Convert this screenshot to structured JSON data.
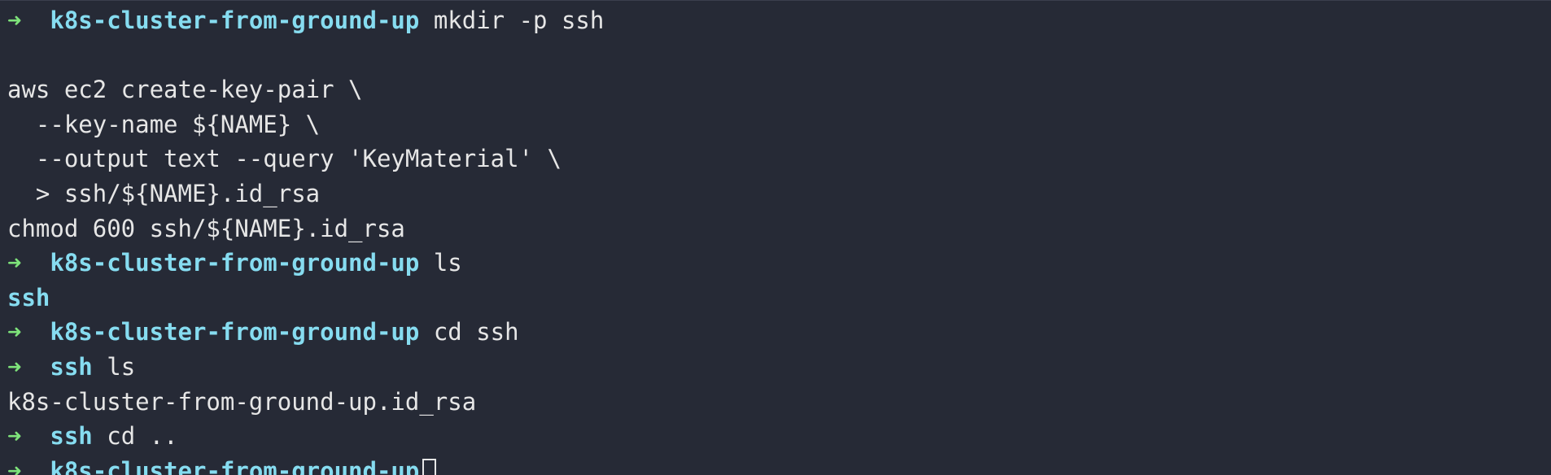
{
  "terminal": {
    "prompt_symbol": "➜",
    "lines": [
      {
        "type": "prompt",
        "dir": "k8s-cluster-from-ground-up",
        "cmd": "mkdir -p ssh"
      },
      {
        "type": "text",
        "text": ""
      },
      {
        "type": "text",
        "text": "aws ec2 create-key-pair \\"
      },
      {
        "type": "text",
        "text": "  --key-name ${NAME} \\"
      },
      {
        "type": "text",
        "text": "  --output text --query 'KeyMaterial' \\"
      },
      {
        "type": "text",
        "text": "  > ssh/${NAME}.id_rsa"
      },
      {
        "type": "text",
        "text": "chmod 600 ssh/${NAME}.id_rsa"
      },
      {
        "type": "prompt",
        "dir": "k8s-cluster-from-ground-up",
        "cmd": "ls"
      },
      {
        "type": "dirout",
        "text": "ssh"
      },
      {
        "type": "prompt",
        "dir": "k8s-cluster-from-ground-up",
        "cmd": "cd ssh"
      },
      {
        "type": "prompt",
        "dir": "ssh",
        "cmd": "ls"
      },
      {
        "type": "text",
        "text": "k8s-cluster-from-ground-up.id_rsa"
      },
      {
        "type": "prompt",
        "dir": "ssh",
        "cmd": "cd .."
      },
      {
        "type": "prompt",
        "dir": "k8s-cluster-from-ground-up",
        "cmd": "",
        "cursor": true
      }
    ]
  },
  "colors": {
    "background": "#262a36",
    "arrow": "#7ee37a",
    "directory": "#86dcf0",
    "text": "#e6e6e6"
  }
}
